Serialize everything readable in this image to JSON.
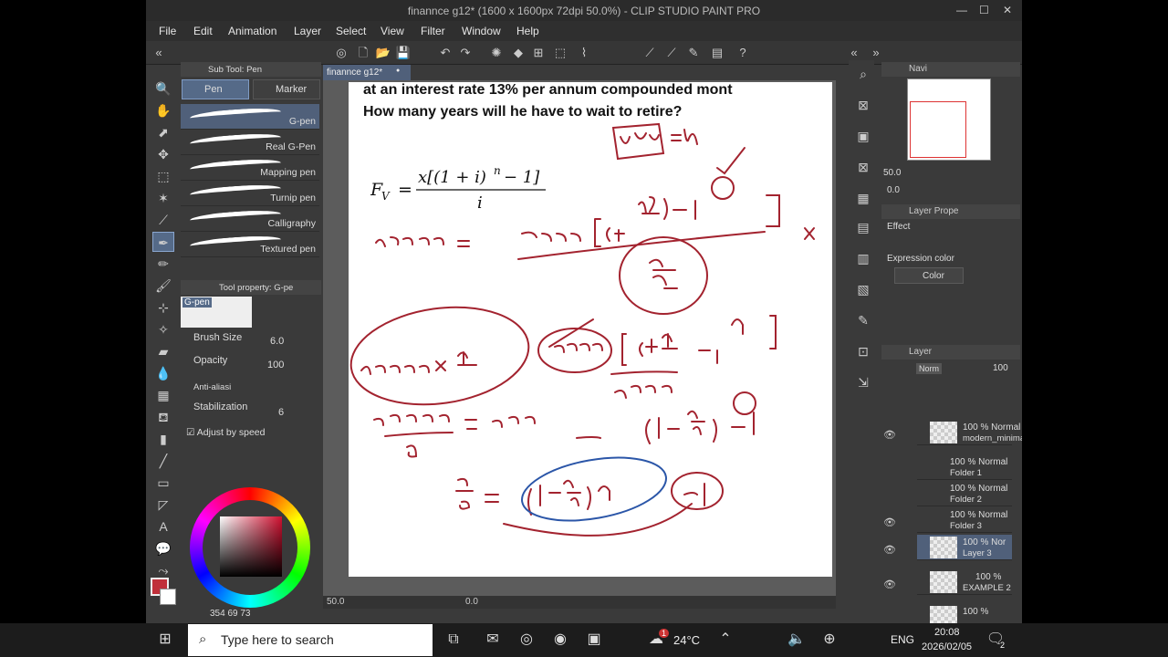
{
  "window": {
    "title": "finannce g12* (1600 x 1600px 72dpi 50.0%)  - CLIP STUDIO PAINT PRO",
    "minimize": "—",
    "maximize": "☐",
    "close": "✕"
  },
  "menu": [
    "File",
    "Edit",
    "Animation",
    "Layer",
    "Select",
    "View",
    "Filter",
    "Window",
    "Help"
  ],
  "subtool": {
    "header": "Sub Tool: Pen",
    "tabs": [
      "Pen",
      "Marker"
    ],
    "brushes": [
      "G-pen",
      "Real G-Pen",
      "Mapping pen",
      "Turnip pen",
      "Calligraphy",
      "Textured pen"
    ]
  },
  "toolprop": {
    "header": "Tool property: G-pe",
    "brush_name": "G-pen",
    "brush_size_label": "Brush Size",
    "brush_size": "6.0",
    "opacity_label": "Opacity",
    "opacity": "100",
    "antialias_label": "Anti-aliasi",
    "stabilization_label": "Stabilization",
    "stabilization": "6",
    "adjust_speed": "Adjust by speed"
  },
  "color": {
    "main": "#c0303a",
    "sub": "#ffffff",
    "readout": "354  69  73"
  },
  "document_tab": {
    "label": "finannce g12*",
    "dot": "●"
  },
  "worksheet": {
    "line1": "at an interest rate 13% per annum compounded mont",
    "line2": "How many years will he have to wait to retire?"
  },
  "status": {
    "zoom": "50.0",
    "angle": "0.0"
  },
  "navigator": {
    "header": "Navi",
    "zoom": "50.0",
    "angle": "0.0"
  },
  "layer_property": {
    "header": "Layer Prope",
    "effect_label": "Effect",
    "expression_label": "Expression color",
    "expression_value": "Color"
  },
  "layers_panel": {
    "header": "Layer",
    "blend": "Norm",
    "opacity": "100",
    "items": [
      {
        "line1": "100 % Normal",
        "line2": "modern_minimal_"
      },
      {
        "line1": "100 % Normal",
        "line2": "Folder 1"
      },
      {
        "line1": "100 % Normal",
        "line2": "Folder 2"
      },
      {
        "line1": "100 % Normal",
        "line2": "Folder 3"
      },
      {
        "line1": "100 % Nor",
        "line2": "Layer 3"
      },
      {
        "line1": "100 %",
        "line2": "EXAMPLE 2"
      },
      {
        "line1": "100 %",
        "line2": ""
      }
    ]
  },
  "taskbar": {
    "search_placeholder": "Type here to search",
    "weather": "24°C",
    "language": "ENG",
    "time": "20:08",
    "date": "2026/02/05",
    "notification_count": "2",
    "badge": "1"
  }
}
